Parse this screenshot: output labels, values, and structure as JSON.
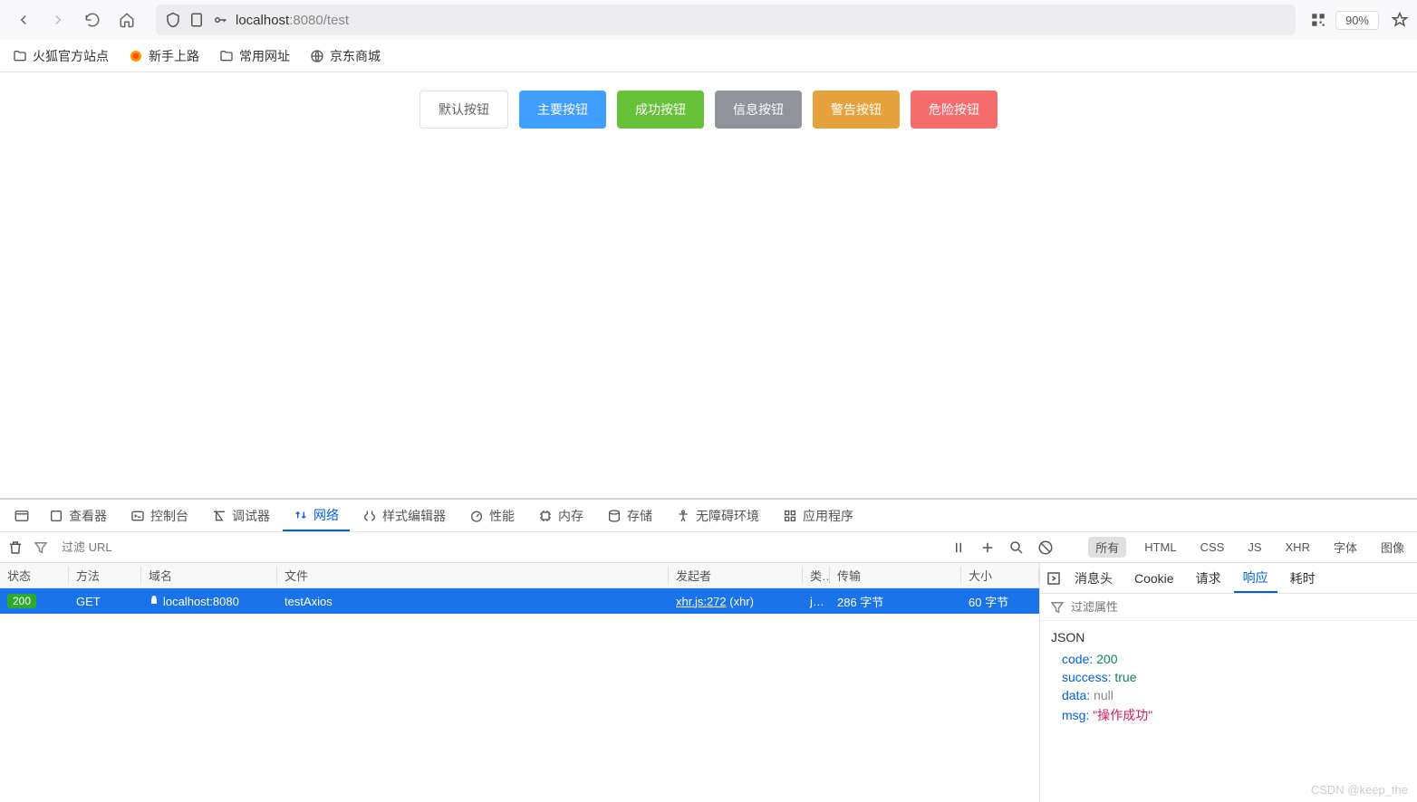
{
  "browser": {
    "url_host": "localhost",
    "url_port": ":8080",
    "url_path": "/test",
    "zoom": "90%"
  },
  "bookmarks": [
    {
      "label": "火狐官方站点",
      "icon": "folder"
    },
    {
      "label": "新手上路",
      "icon": "firefox"
    },
    {
      "label": "常用网址",
      "icon": "folder"
    },
    {
      "label": "京东商城",
      "icon": "globe"
    }
  ],
  "buttons": {
    "default": "默认按钮",
    "primary": "主要按钮",
    "success": "成功按钮",
    "info": "信息按钮",
    "warning": "警告按钮",
    "danger": "危险按钮"
  },
  "devtools": {
    "tabs": [
      "查看器",
      "控制台",
      "调试器",
      "网络",
      "样式编辑器",
      "性能",
      "内存",
      "存储",
      "无障碍环境",
      "应用程序"
    ],
    "activeTab": 3,
    "filter_placeholder": "过滤 URL",
    "filters": [
      "所有",
      "HTML",
      "CSS",
      "JS",
      "XHR",
      "字体",
      "图像"
    ],
    "columns": [
      "状态",
      "方法",
      "域名",
      "文件",
      "发起者",
      "类…",
      "传输",
      "大小"
    ],
    "row": {
      "status": "200",
      "method": "GET",
      "domain": "localhost:8080",
      "file": "testAxios",
      "initiator_link": "xhr.js:272",
      "initiator_suffix": " (xhr)",
      "type": "j…",
      "transfer": "286 字节",
      "size": "60 字节"
    },
    "detail_tabs": [
      "消息头",
      "Cookie",
      "请求",
      "响应",
      "耗时"
    ],
    "detail_active": 3,
    "detail_filter_placeholder": "过滤属性",
    "json_label": "JSON",
    "json": {
      "code_k": "code:",
      "code_v": "200",
      "success_k": "success:",
      "success_v": "true",
      "data_k": "data:",
      "data_v": "null",
      "msg_k": "msg:",
      "msg_v": "\"操作成功\""
    }
  },
  "watermark": "CSDN @keep_the"
}
